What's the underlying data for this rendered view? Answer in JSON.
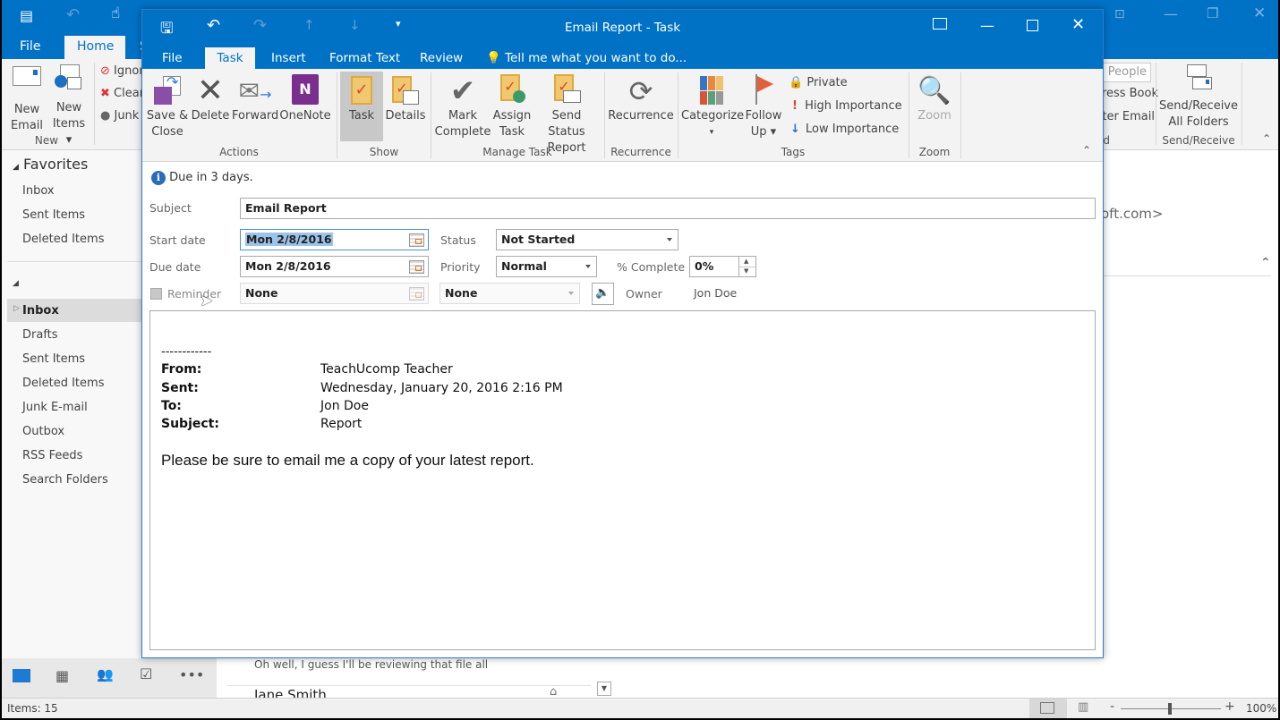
{
  "main_window": {
    "tabs": [
      "File",
      "Home",
      "S"
    ],
    "active_tab": "Home",
    "ribbon": {
      "new_email": "New\nEmail",
      "new_email_l1": "New",
      "new_email_l2": "Email",
      "new_items_l1": "New",
      "new_items_l2": "Items ▾",
      "group_new": "New",
      "ignore": "Ignore",
      "clean_up": "Clean Up",
      "junk": "Junk",
      "people_search_placeholder": "Search People",
      "address_book": "Address Book",
      "filter_email": "Filter Email ▾",
      "group_find": "Find",
      "send_receive_l1": "Send/Receive",
      "send_receive_l2": "All Folders",
      "group_send_receive": "Send/Receive"
    },
    "nav": {
      "favorites_header": "Favorites",
      "favorites": [
        "Inbox",
        "Sent Items",
        "Deleted Items"
      ],
      "folders": [
        "Inbox",
        "Drafts",
        "Sent Items",
        "Deleted Items",
        "Junk E-mail",
        "Outbox",
        "RSS Feeds",
        "Search Folders"
      ],
      "selected_folder": "Inbox"
    },
    "reading_pane_fragment": "oft.com>",
    "message_list": {
      "preview_text": "Oh well, I guess I'll be reviewing that file all",
      "next_sender": "Jane Smith"
    },
    "status": {
      "items": "Items: 15",
      "zoom": "100%"
    }
  },
  "task_window": {
    "title": "Email Report - Task",
    "tabs": [
      "File",
      "Task",
      "Insert",
      "Format Text",
      "Review"
    ],
    "active_tab": "Task",
    "tell_me": "Tell me what you want to do...",
    "ribbon": {
      "actions": {
        "save_close_l1": "Save &",
        "save_close_l2": "Close",
        "delete": "Delete",
        "forward": "Forward",
        "onenote": "OneNote",
        "label": "Actions"
      },
      "show": {
        "task": "Task",
        "details": "Details",
        "label": "Show"
      },
      "manage": {
        "mark_l1": "Mark",
        "mark_l2": "Complete",
        "assign_l1": "Assign",
        "assign_l2": "Task",
        "status_l1": "Send Status",
        "status_l2": "Report",
        "label": "Manage Task"
      },
      "recurrence": {
        "button": "Recurrence",
        "label": "Recurrence"
      },
      "tags": {
        "categorize": "Categorize",
        "follow_l1": "Follow",
        "follow_l2": "Up ▾",
        "private": "Private",
        "high": "High Importance",
        "low": "Low Importance",
        "label": "Tags"
      },
      "zoom": {
        "button": "Zoom",
        "label": "Zoom"
      }
    },
    "info_bar": "Due in 3 days.",
    "form": {
      "subject_label": "Subject",
      "subject": "Email Report",
      "start_label": "Start date",
      "start": "Mon 2/8/2016",
      "due_label": "Due date",
      "due": "Mon 2/8/2016",
      "status_label": "Status",
      "status": "Not Started",
      "priority_label": "Priority",
      "priority": "Normal",
      "pct_label": "% Complete",
      "pct": "0%",
      "reminder_label": "Reminder",
      "reminder_checked": false,
      "reminder_date": "None",
      "reminder_time": "None",
      "owner_label": "Owner",
      "owner": "Jon Doe"
    },
    "body": {
      "separator": "------------",
      "from_label": "From:",
      "from": "TeachUcomp Teacher",
      "sent_label": "Sent:",
      "sent": "Wednesday, January 20, 2016 2:16 PM",
      "to_label": "To:",
      "to": "Jon Doe",
      "subject_label": "Subject:",
      "subject": "Report",
      "message": "Please be sure to email me a copy of your latest report."
    }
  }
}
